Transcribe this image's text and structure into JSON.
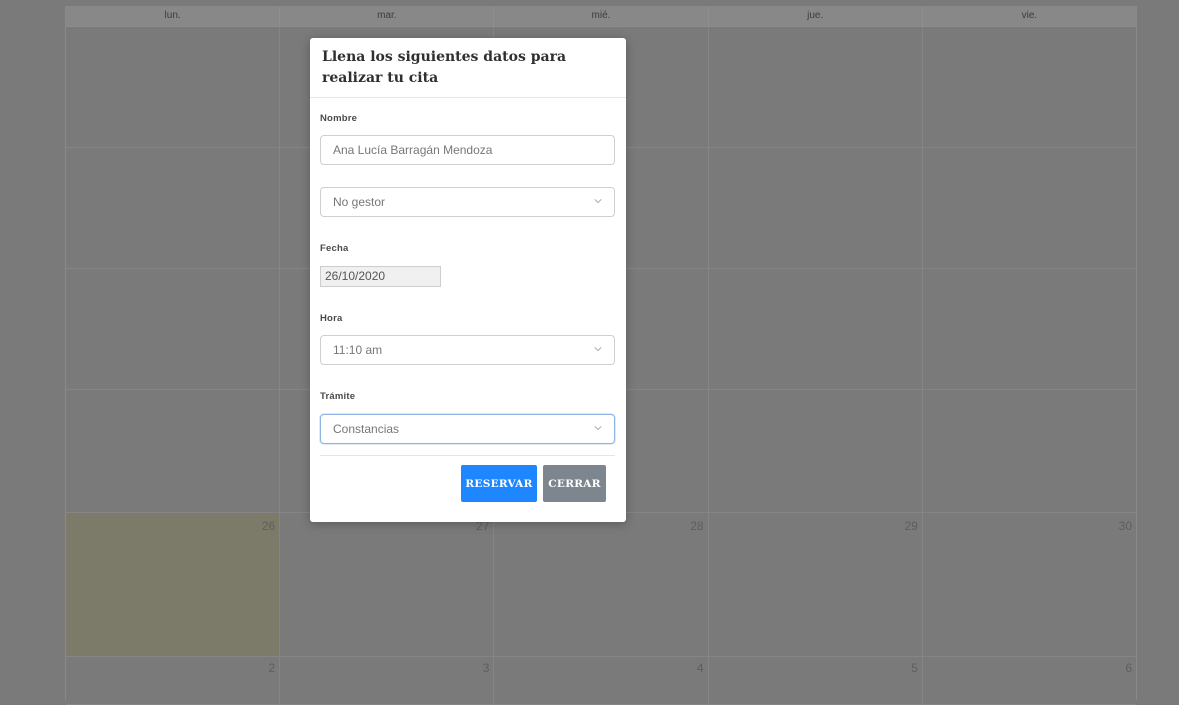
{
  "calendar": {
    "weekdays": [
      "lun.",
      "mar.",
      "mié.",
      "jue.",
      "vie."
    ],
    "week5_days": [
      "26",
      "27",
      "28",
      "29",
      "30"
    ],
    "week6_days": [
      "2",
      "3",
      "4",
      "5",
      "6"
    ]
  },
  "modal": {
    "title": "Llena los siguientes datos para realizar tu cita",
    "nombre_label": "Nombre",
    "nombre_value": "Ana Lucía Barragán Mendoza",
    "gestor_value": "No gestor",
    "fecha_label": "Fecha",
    "fecha_value": "26/10/2020",
    "hora_label": "Hora",
    "hora_value": "11:10 am",
    "tramite_label": "Trámite",
    "tramite_value": "Constancias",
    "reserve_label": "RESERVAR",
    "close_label": "CERRAR"
  },
  "colors": {
    "primary": "#1e87ff",
    "secondary": "#7d868f",
    "today_highlight": "#7c7a68",
    "overlay": "#7a7a7a"
  },
  "icons": {
    "select_arrow": "chevron-down-icon"
  }
}
